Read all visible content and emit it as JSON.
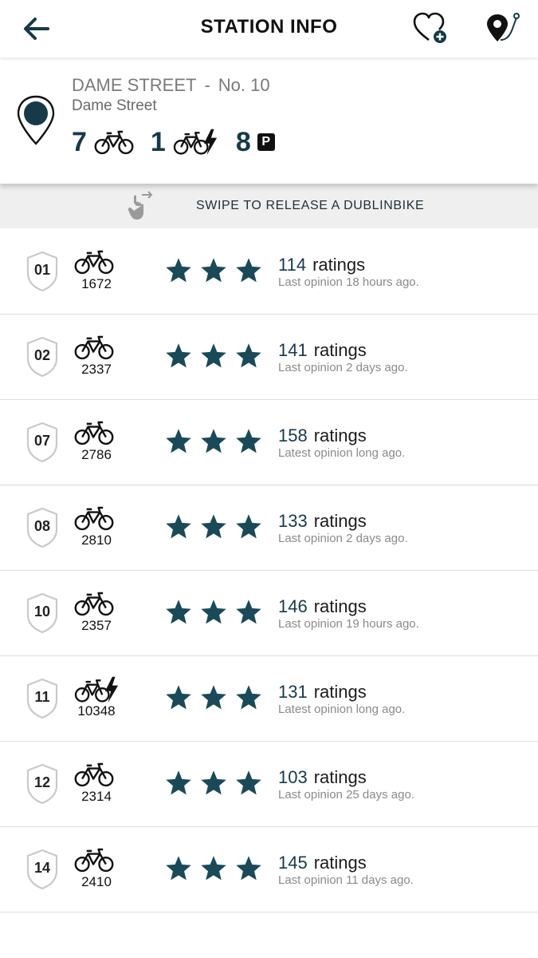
{
  "header": {
    "title": "STATION INFO",
    "back_icon": "arrow-left-icon",
    "favorite_icon": "heart-plus-icon",
    "map_icon": "map-pin-route-icon"
  },
  "station": {
    "name": "DAME STREET",
    "separator": "-",
    "number": "No. 10",
    "address": "Dame Street",
    "bikes_available": "7",
    "ebikes_available": "1",
    "parking_available": "8",
    "parking_badge": "P"
  },
  "swipe_hint": {
    "text": "SWIPE TO RELEASE A DUBLINBIKE"
  },
  "colors": {
    "accent": "#163a48",
    "star": "#1a4a58",
    "muted": "#8a8a8a"
  },
  "rows": [
    {
      "dock": "01",
      "type": "bike",
      "bike_id": "1672",
      "rating_count": "114",
      "ratings_label": "ratings",
      "opinion": "Last opinion 18 hours ago.",
      "stars": 3
    },
    {
      "dock": "02",
      "type": "bike",
      "bike_id": "2337",
      "rating_count": "141",
      "ratings_label": "ratings",
      "opinion": "Last opinion 2 days ago.",
      "stars": 3
    },
    {
      "dock": "07",
      "type": "bike",
      "bike_id": "2786",
      "rating_count": "158",
      "ratings_label": "ratings",
      "opinion": "Latest opinion long ago.",
      "stars": 3
    },
    {
      "dock": "08",
      "type": "bike",
      "bike_id": "2810",
      "rating_count": "133",
      "ratings_label": "ratings",
      "opinion": "Last opinion 2 days ago.",
      "stars": 3
    },
    {
      "dock": "10",
      "type": "bike",
      "bike_id": "2357",
      "rating_count": "146",
      "ratings_label": "ratings",
      "opinion": "Last opinion 19 hours ago.",
      "stars": 3
    },
    {
      "dock": "11",
      "type": "ebike",
      "bike_id": "10348",
      "rating_count": "131",
      "ratings_label": "ratings",
      "opinion": "Latest opinion long ago.",
      "stars": 3
    },
    {
      "dock": "12",
      "type": "bike",
      "bike_id": "2314",
      "rating_count": "103",
      "ratings_label": "ratings",
      "opinion": "Last opinion 25 days ago.",
      "stars": 3
    },
    {
      "dock": "14",
      "type": "bike",
      "bike_id": "2410",
      "rating_count": "145",
      "ratings_label": "ratings",
      "opinion": "Last opinion 11 days ago.",
      "stars": 3
    }
  ]
}
